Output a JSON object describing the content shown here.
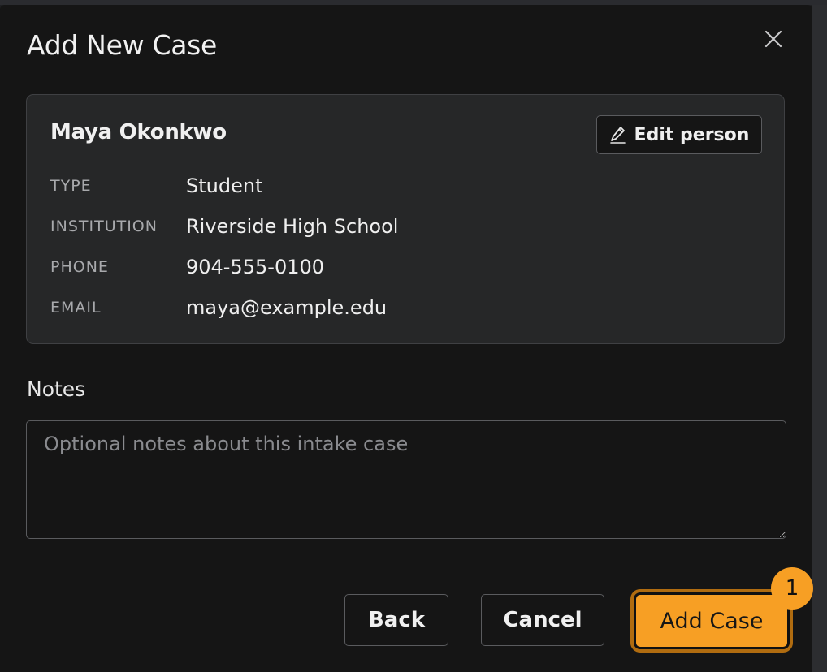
{
  "modal": {
    "title": "Add New Case",
    "close_icon": "close-icon"
  },
  "person_card": {
    "name": "Maya Okonkwo",
    "edit_button_label": "Edit person",
    "edit_icon": "pencil-icon",
    "fields": [
      {
        "key": "TYPE",
        "value": "Student"
      },
      {
        "key": "INSTITUTION",
        "value": "Riverside High School"
      },
      {
        "key": "PHONE",
        "value": "904-555-0100"
      },
      {
        "key": "EMAIL",
        "value": "maya@example.edu"
      }
    ]
  },
  "notes": {
    "label": "Notes",
    "placeholder": "Optional notes about this intake case",
    "value": ""
  },
  "footer": {
    "back_label": "Back",
    "cancel_label": "Cancel",
    "add_label": "Add Case",
    "add_badge": "1"
  },
  "colors": {
    "accent": "#f79f24",
    "background": "#151515",
    "card": "#262728"
  }
}
